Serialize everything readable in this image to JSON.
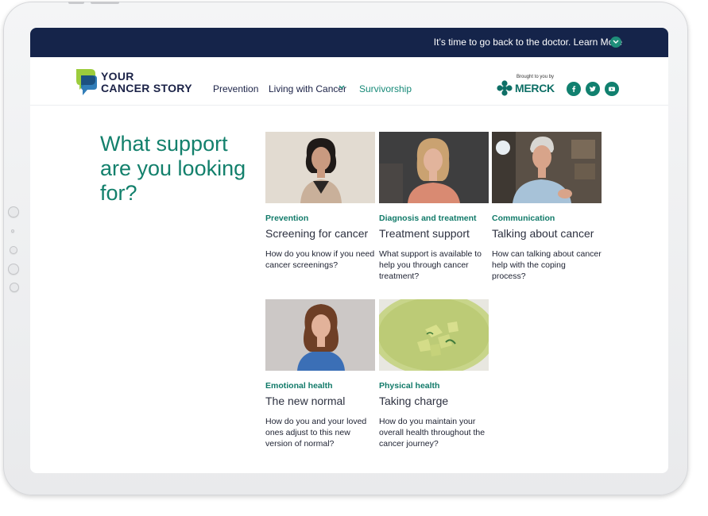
{
  "banner": {
    "text": "It’s time to go back to the doctor. Learn More"
  },
  "logo": {
    "line1": "YOUR",
    "line2": "CANCER STORY"
  },
  "nav": [
    {
      "label": "Prevention"
    },
    {
      "label": "Living with Cancer"
    },
    {
      "label": "Survivorship"
    }
  ],
  "sponsor": {
    "brought": "Brought to you by",
    "name": "MERCK"
  },
  "social_icons": [
    "facebook-icon",
    "twitter-icon",
    "youtube-icon"
  ],
  "hero": {
    "title": "What support are you looking for?"
  },
  "cards": [
    {
      "category": "Prevention",
      "title": "Screening for cancer",
      "description": "How do you know if you need cancer screenings?"
    },
    {
      "category": "Diagnosis and treatment",
      "title": "Treatment support",
      "description": "What support is available to help you through cancer treatment?"
    },
    {
      "category": "Communication",
      "title": "Talking about cancer",
      "description": "How can talking about cancer help with the coping process?"
    },
    {
      "category": "Emotional health",
      "title": "The new normal",
      "description": "How do you and your loved ones adjust to this new version of normal?"
    },
    {
      "category": "Physical health",
      "title": "Taking charge",
      "description": "How do you maintain your overall health throughout the cancer journey?"
    }
  ],
  "colors": {
    "navy": "#15244a",
    "teal": "#13806c",
    "accent": "#1f8e7a"
  }
}
